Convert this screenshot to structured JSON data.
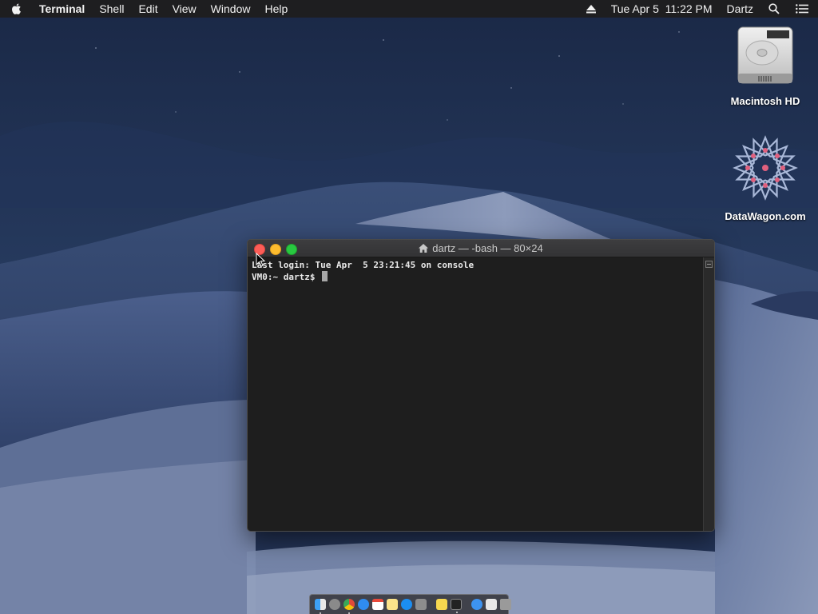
{
  "menubar": {
    "app_name": "Terminal",
    "menus": [
      "Shell",
      "Edit",
      "View",
      "Window",
      "Help"
    ],
    "datetime": "Tue Apr 5  11:22 PM",
    "user": "Dartz",
    "icons": [
      "apple-icon",
      "eject-icon",
      "spotlight-search-icon",
      "notification-center-icon"
    ]
  },
  "desktop": {
    "icons": [
      {
        "label": "Macintosh HD",
        "icon": "hard-drive-icon"
      },
      {
        "label": "DataWagon.com",
        "icon": "datawagon-logo-icon"
      }
    ]
  },
  "terminal": {
    "title": "dartz — -bash — 80×24",
    "lines": [
      "Last login: Tue Apr  5 23:21:45 on console",
      "VM0:~ dartz$ "
    ]
  },
  "dock": {
    "items": [
      "finder-icon",
      "launchpad-icon",
      "chrome-icon",
      "safari-icon",
      "calendar-icon",
      "notes-icon",
      "app-store-icon",
      "system-preferences-icon",
      "notes-folder-icon",
      "terminal-icon",
      "app-store-folder-icon",
      "documents-icon",
      "trash-icon"
    ]
  },
  "colors": {
    "menubar_bg": "#1e1e20",
    "terminal_bg": "#1e1e1e",
    "close": "#fd5d57",
    "minimize": "#fdbc2e",
    "maximize": "#28c840"
  }
}
